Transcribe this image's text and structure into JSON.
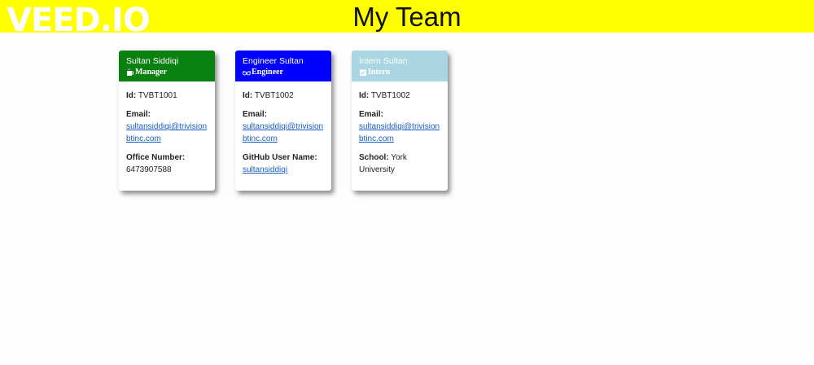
{
  "header": {
    "watermark": "VEED.IO",
    "title": "My Team",
    "background": "#ffff00"
  },
  "cards": [
    {
      "name": "Sultan Siddiqi",
      "role": "Manager",
      "icon": "coffee-mug-icon",
      "color": "#0a8010",
      "id_label": "Id:",
      "id": "TVBT1001",
      "email_label": "Email:",
      "email_line1": "sultansiddiqi@trivision",
      "email_line2": "btinc.com",
      "extra_label": "Office Number:",
      "extra_value": "6473907588"
    },
    {
      "name": "Engineer Sultan",
      "role": "Engineer",
      "icon": "glasses-icon",
      "color": "#0000ff",
      "id_label": "Id:",
      "id": "TVBT1002",
      "email_label": "Email:",
      "email_line1": "sultansiddiqi@trivision",
      "email_line2": "btinc.com",
      "extra_label": "GitHub User Name:",
      "extra_value": "sultansiddiqi"
    },
    {
      "name": "Intern Sultan",
      "role": "Intern",
      "icon": "graduation-icon",
      "color": "#a9d6e2",
      "id_label": "Id:",
      "id": "TVBT1002",
      "email_label": "Email:",
      "email_line1": "sultansiddiqi@trivision",
      "email_line2": "btinc.com",
      "extra_label": "School:",
      "extra_value": "York University"
    }
  ]
}
